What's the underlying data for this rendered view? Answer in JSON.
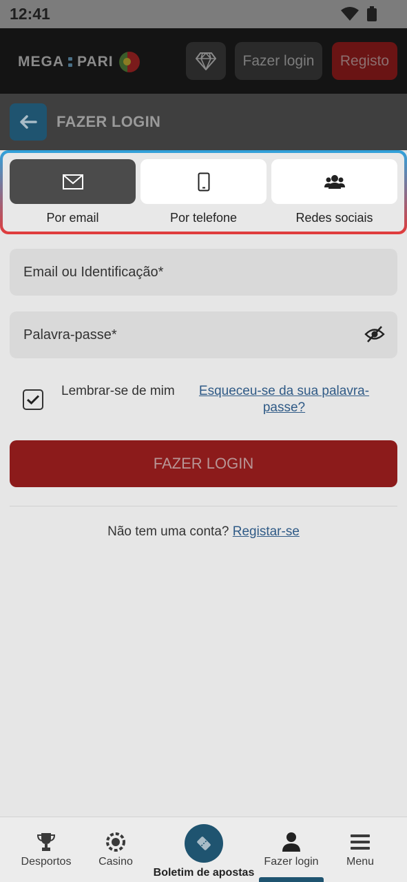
{
  "status_bar": {
    "time": "12:41",
    "wifi_icon": "wifi-icon",
    "battery_icon": "battery-icon"
  },
  "header": {
    "logo_left": "MEGA",
    "logo_right": "PARI",
    "vip_icon": "diamond-icon",
    "login_label": "Fazer login",
    "register_label": "Registo"
  },
  "subheader": {
    "title": "FAZER LOGIN",
    "back_icon": "arrow-left-icon"
  },
  "tabs": [
    {
      "label": "Por email",
      "icon": "envelope-icon",
      "active": true
    },
    {
      "label": "Por telefone",
      "icon": "phone-icon",
      "active": false
    },
    {
      "label": "Redes sociais",
      "icon": "users-icon",
      "active": false
    }
  ],
  "form": {
    "email_placeholder": "Email ou Identificação*",
    "password_placeholder": "Palavra-passe*",
    "remember_label": "Lembrar-se de mim",
    "remember_checked": true,
    "forgot_label": "Esqueceu-se da sua palavra-passe?",
    "submit_label": "FAZER LOGIN",
    "no_account_text": "Não tem uma conta?",
    "signup_link": "Registar-se"
  },
  "bottom_nav": [
    {
      "label": "Desportos",
      "icon": "trophy-icon"
    },
    {
      "label": "Casino",
      "icon": "casino-chip-icon"
    },
    {
      "label": "Boletim de apostas",
      "icon": "ticket-icon"
    },
    {
      "label": "Fazer login",
      "icon": "user-icon"
    },
    {
      "label": "Menu",
      "icon": "menu-icon"
    }
  ],
  "colors": {
    "accent_blue": "#1f5470",
    "accent_red": "#8c1b1b",
    "link": "#2f5a86"
  }
}
